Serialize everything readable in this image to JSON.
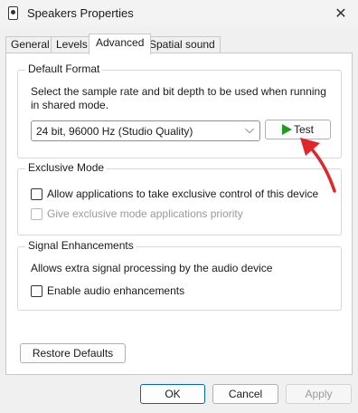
{
  "window": {
    "title": "Speakers Properties",
    "icon": "speaker-icon",
    "close_glyph": "✕"
  },
  "tabs": [
    {
      "label": "General"
    },
    {
      "label": "Levels"
    },
    {
      "label": "Advanced"
    },
    {
      "label": "Spatial sound"
    }
  ],
  "default_format": {
    "title": "Default Format",
    "description_line1": "Select the sample rate and bit depth to be used when running",
    "description_line2": "in shared mode.",
    "selected": "24 bit, 96000 Hz (Studio Quality)",
    "test_label": "Test",
    "play_icon_color": "#1f9c1f"
  },
  "exclusive_mode": {
    "title": "Exclusive Mode",
    "allow_label": "Allow applications to take exclusive control of this device",
    "priority_label": "Give exclusive mode applications priority"
  },
  "signal": {
    "title": "Signal Enhancements",
    "description": "Allows extra signal processing by the audio device",
    "enable_label": "Enable audio enhancements"
  },
  "restore_label": "Restore Defaults",
  "footer": {
    "ok": "OK",
    "cancel": "Cancel",
    "apply": "Apply"
  },
  "colors": {
    "accent": "#0067c0",
    "annotation_arrow": "#e0262b"
  }
}
